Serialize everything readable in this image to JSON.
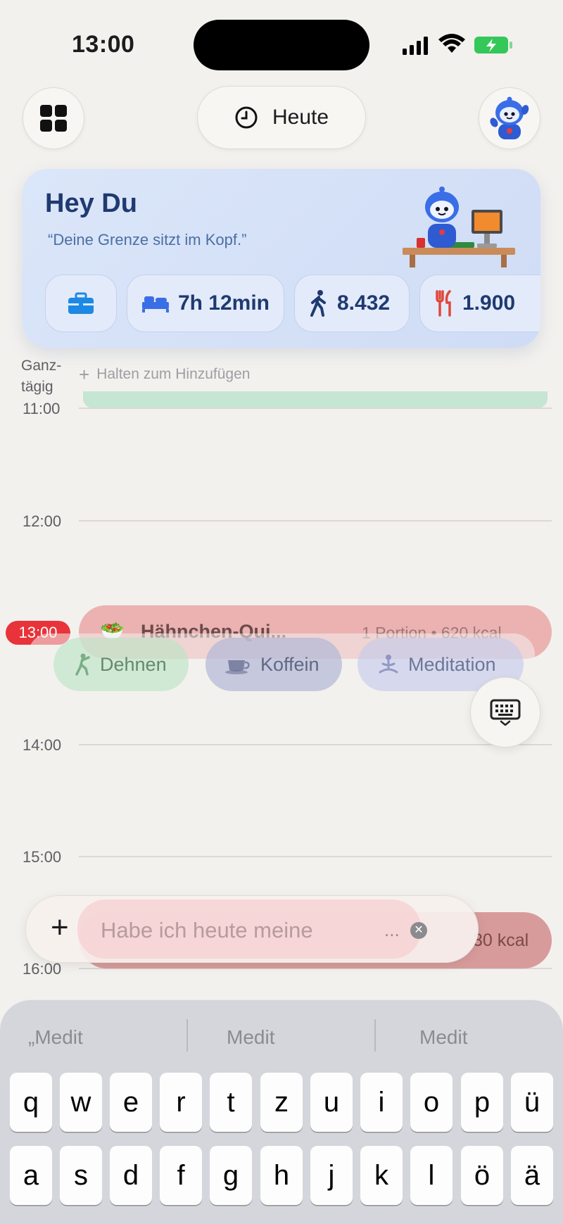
{
  "status_bar": {
    "time": "13:00"
  },
  "nav": {
    "today_label": "Heute"
  },
  "hero": {
    "title": "Hey Du",
    "quote": "“Deine Grenze sitzt im Kopf.”",
    "chips": {
      "sleep": "7h 12min",
      "steps": "8.432",
      "food": "1.900"
    }
  },
  "calendar": {
    "allday_label_1": "Ganz-",
    "allday_label_2": "tägig",
    "allday_hint": "Halten zum Hinzufügen",
    "hours": [
      "11:00",
      "12:00",
      "13:00",
      "14:00",
      "15:00",
      "16:00"
    ],
    "now_label": "13:00",
    "meal_event": {
      "title": "Hähnchen-Qui...",
      "info": "1 Portion • 620 kcal"
    },
    "ghost_event_kcal": "30 kcal"
  },
  "suggestions": {
    "dehnen": "Dehnen",
    "koffein": "Koffein",
    "meditation": "Meditation"
  },
  "input": {
    "text": "Habe ich heute meine",
    "ellipsis": "..."
  },
  "keyboard": {
    "predictions": [
      "„Medit",
      "Medit",
      "Medit"
    ],
    "row1": [
      "q",
      "w",
      "e",
      "r",
      "t",
      "z",
      "u",
      "i",
      "o",
      "p",
      "ü"
    ],
    "row2": [
      "a",
      "s",
      "d",
      "f",
      "g",
      "h",
      "j",
      "k",
      "l",
      "ö",
      "ä"
    ]
  },
  "colors": {
    "accent_red": "#e8333a",
    "hero_bg": "#d6e2f8",
    "event_green": "#c4e6d3",
    "meal_red": "#e9a8a8"
  }
}
